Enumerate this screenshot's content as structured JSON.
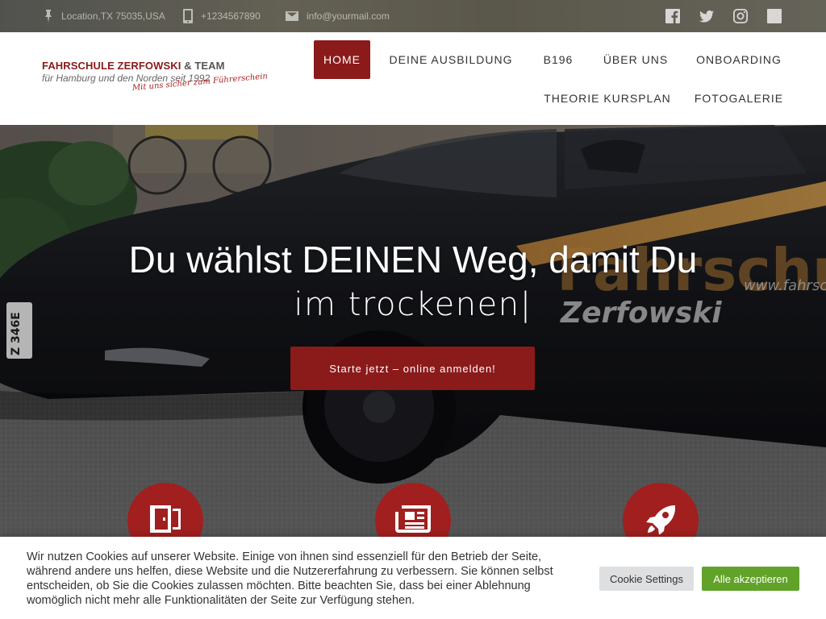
{
  "topbar": {
    "location": "Location,TX 75035,USA",
    "phone": "+1234567890",
    "email": "info@yourmail.com",
    "social_icons": [
      "facebook-icon",
      "twitter-icon",
      "instagram-icon",
      "google-plus-icon"
    ]
  },
  "logo": {
    "line1_brand": "FAHRSCHULE ZERFOWSKI",
    "line1_team": "& TEAM",
    "line2": "für Hamburg und den Norden seit 1992",
    "slogan": "Mit uns sicher zum Führerschein"
  },
  "nav": {
    "items": [
      {
        "label": "HOME",
        "active": true
      },
      {
        "label": "DEINE AUSBILDUNG",
        "active": false
      },
      {
        "label": "B196",
        "active": false
      },
      {
        "label": "ÜBER UNS",
        "active": false
      },
      {
        "label": "ONBOARDING",
        "active": false
      },
      {
        "label": "THEORIE KURSPLAN",
        "active": false
      },
      {
        "label": "FOTOGALERIE",
        "active": false
      }
    ]
  },
  "hero": {
    "title_line1": "Du wählst DEINEN Weg, damit Du",
    "title_line2": "im trockenen|",
    "cta_label": "Starte jetzt – online anmelden!",
    "car_text_main": "Fahrschule",
    "car_text_name": "Zerfowski",
    "car_text_url": "www.fahrschule",
    "plate": "Z 346E",
    "feature_icons": [
      "door-icon",
      "newspaper-icon",
      "rocket-icon"
    ]
  },
  "cookie": {
    "text": "Wir nutzen Cookies auf unserer Website. Einige von ihnen sind essenziell für den Betrieb der Seite, während andere uns helfen, diese Website und die Nutzererfahrung zu verbessern. Sie können selbst entscheiden, ob Sie die Cookies zulassen möchten. Bitte beachten Sie, dass bei einer Ablehnung womöglich nicht mehr alle Funktionalitäten der Seite zur Verfügung stehen.",
    "settings_label": "Cookie Settings",
    "accept_label": "Alle akzeptieren"
  },
  "colors": {
    "brand_red": "#8b1a1a",
    "accept_green": "#61a229",
    "settings_grey": "#dedfe0"
  }
}
